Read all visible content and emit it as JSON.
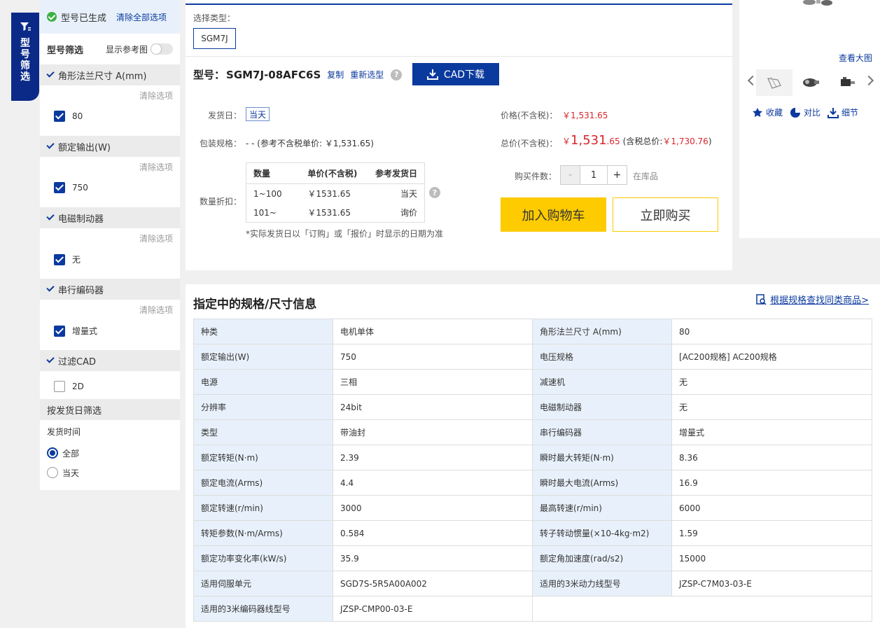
{
  "filter_tab": {
    "label": "型号筛选"
  },
  "sidebar": {
    "generated_text": "型号已生成",
    "clear_all": "清除全部选项",
    "filter_title": "型号筛选",
    "show_ref_label": "显示参考图",
    "clear_option": "清除选项",
    "filters": [
      {
        "title": "角形法兰尺寸 A(mm)",
        "option": "80",
        "checked": true
      },
      {
        "title": "额定输出(W)",
        "option": "750",
        "checked": true
      },
      {
        "title": "电磁制动器",
        "option": "无",
        "checked": true
      },
      {
        "title": "串行编码器",
        "option": "增量式",
        "checked": true
      }
    ],
    "cad_filter": {
      "title": "过滤CAD",
      "option": "2D",
      "checked": false
    },
    "ship_filter": {
      "title": "按发货日筛选",
      "label": "发货时间",
      "options": [
        "全部",
        "当天"
      ],
      "selected": "全部"
    }
  },
  "product": {
    "select_type_label": "选择类型：",
    "type": "SGM7J",
    "model_label": "型号：",
    "model": "SGM7J-08AFC6S",
    "copy": "复制",
    "reselect": "重新选型",
    "cad_button": "CAD下载",
    "ship_label": "发货日：",
    "ship_value": "当天",
    "pack_label": "包装规格：",
    "pack_value": "- - (参考不含税单价: ￥1,531.65)",
    "discount_label": "数量折扣：",
    "qty_table": {
      "headers": [
        "数量",
        "单价(不含税)",
        "参考发货日"
      ],
      "rows": [
        [
          "1~100",
          "￥1531.65",
          "当天"
        ],
        [
          "101~",
          "￥1531.65",
          "询价"
        ]
      ]
    },
    "note": "*实际发货日以「订购」或「报价」时显示的日期为准",
    "price_label": "价格(不含税)：",
    "price": "￥1,531.65",
    "total_label": "总价(不含税)：",
    "total_currency": "￥",
    "total_int": "1,531",
    "total_dec": ".65",
    "total_tax_prefix": "(含税总价:",
    "total_tax": "￥1,730.76",
    "total_tax_suffix": ")",
    "qty_label": "购买件数：",
    "qty_minus": "-",
    "qty_value": "1",
    "qty_plus": "+",
    "stock": "在库品",
    "add_cart": "加入购物车",
    "buy_now": "立即购买"
  },
  "gallery": {
    "view_large": "查看大图",
    "favorite": "收藏",
    "compare": "对比",
    "detail": "细节"
  },
  "specs": {
    "title": "指定中的规格/尺寸信息",
    "link": "根据规格查找同类商品>",
    "rows": [
      [
        "种类",
        "电机单体",
        "角形法兰尺寸 A(mm)",
        "80"
      ],
      [
        "额定输出(W)",
        "750",
        "电压规格",
        "[AC200规格] AC200规格"
      ],
      [
        "电源",
        "三相",
        "减速机",
        "无"
      ],
      [
        "分辨率",
        "24bit",
        "电磁制动器",
        "无"
      ],
      [
        "类型",
        "带油封",
        "串行编码器",
        "增量式"
      ],
      [
        "额定转矩(N·m)",
        "2.39",
        "瞬时最大转矩(N·m)",
        "8.36"
      ],
      [
        "额定电流(Arms)",
        "4.4",
        "瞬时最大电流(Arms)",
        "16.9"
      ],
      [
        "额定转速(r/min)",
        "3000",
        "最高转速(r/min)",
        "6000"
      ],
      [
        "转矩参数(N·m/Arms)",
        "0.584",
        "转子转动惯量(×10-4kg·m2)",
        "1.59"
      ],
      [
        "额定功率变化率(kW/s)",
        "35.9",
        "额定角加速度(rad/s2)",
        "15000"
      ],
      [
        "适用伺服单元",
        "SGD7S-5R5A00A002",
        "适用的3米动力线型号",
        "JZSP-C7M03-03-E"
      ],
      [
        "适用的3米编码器线型号",
        "JZSP-CMP00-03-E",
        "",
        ""
      ]
    ]
  },
  "colors": {
    "brand": "#0b3a9e",
    "accent": "#fdcb00",
    "price": "#d9262c"
  }
}
